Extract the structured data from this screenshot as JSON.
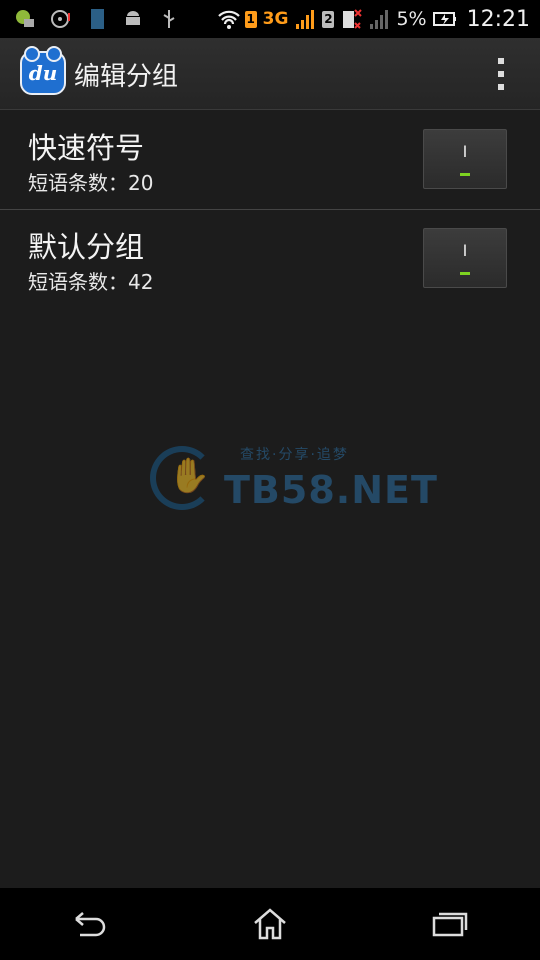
{
  "status_bar": {
    "sim1_badge": "1",
    "network_type": "3G",
    "sim2_badge": "2",
    "battery_percent": "5%",
    "time": "12:21"
  },
  "action_bar": {
    "logo_text": "du",
    "title": "编辑分组"
  },
  "groups": [
    {
      "title": "快速符号",
      "count_label": "短语条数：20",
      "toggle_label": "I",
      "toggle_on": true
    },
    {
      "title": "默认分组",
      "count_label": "短语条数：42",
      "toggle_label": "I",
      "toggle_on": true
    }
  ],
  "watermark": {
    "text": "TB58.NET",
    "tagline": "查找·分享·追梦"
  },
  "nav": {
    "back_icon": "back-icon",
    "home_icon": "home-icon",
    "recents_icon": "recents-icon"
  },
  "colors": {
    "toggle_on": "#7ed321",
    "network_accent": "#ff9c1a",
    "logo_blue": "#1f6fd0"
  }
}
